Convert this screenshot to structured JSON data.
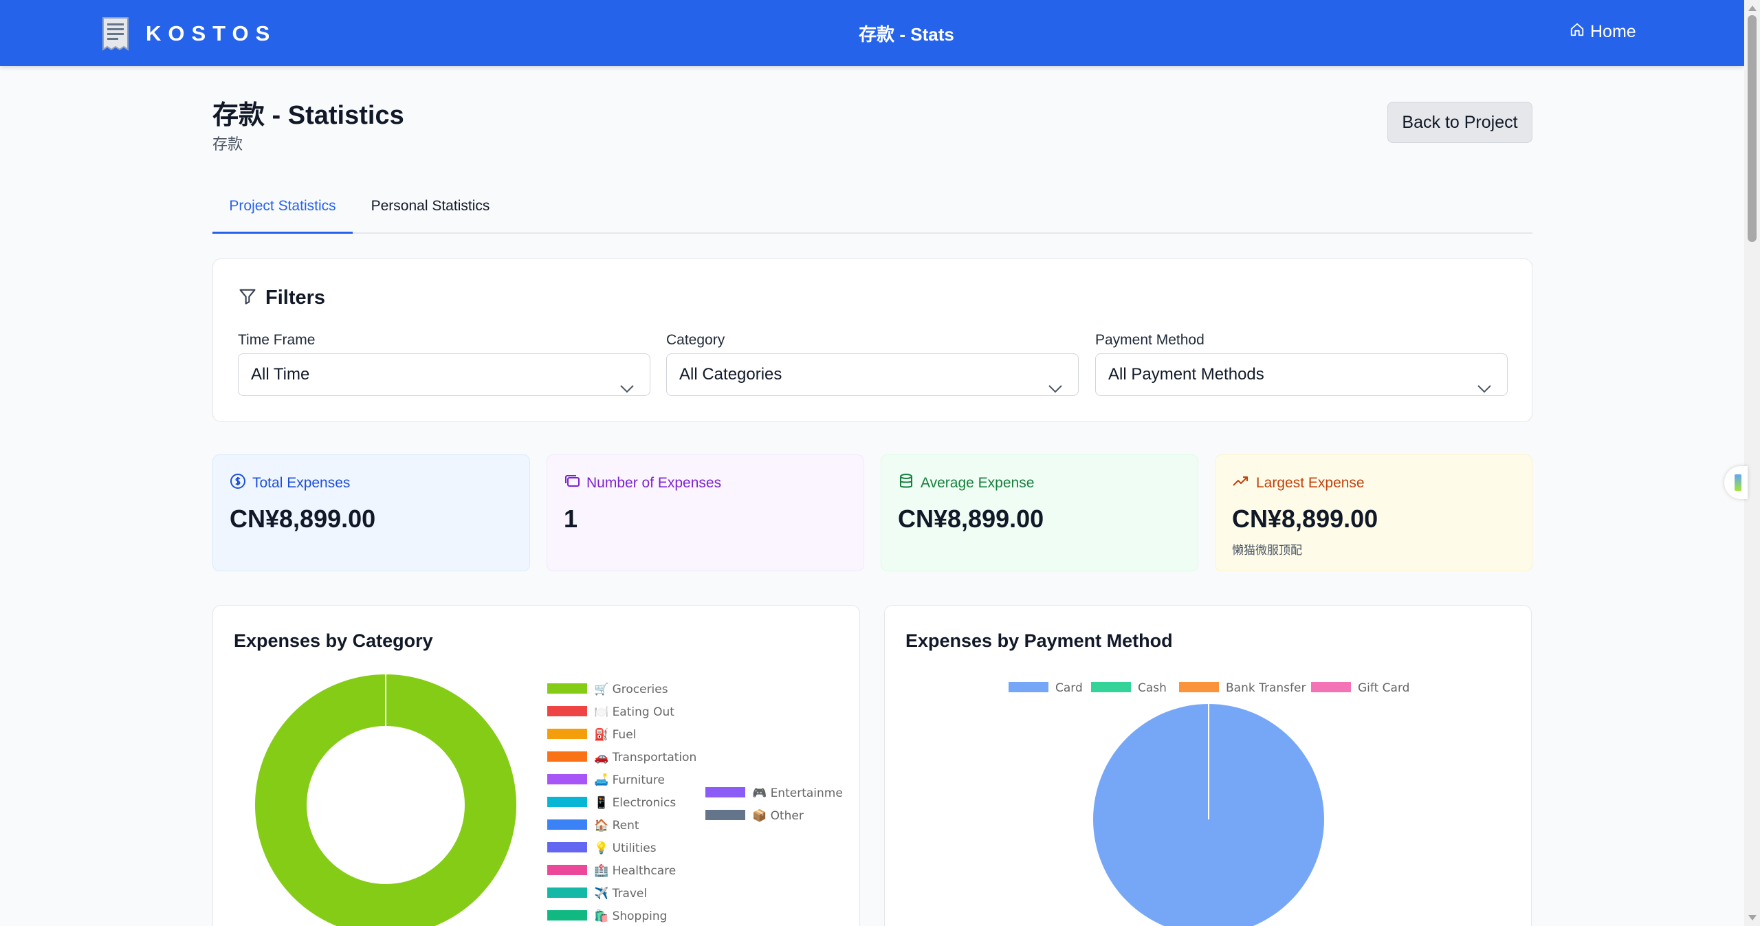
{
  "header": {
    "brand": "KOSTOS",
    "title": "存款 - Stats",
    "home_label": "Home"
  },
  "page": {
    "title": "存款 - Statistics",
    "subtitle": "存款",
    "back_label": "Back to Project"
  },
  "tabs": {
    "project": "Project Statistics",
    "personal": "Personal Statistics",
    "active": "project"
  },
  "filters": {
    "title": "Filters",
    "time_frame": {
      "label": "Time Frame",
      "value": "All Time"
    },
    "category": {
      "label": "Category",
      "value": "All Categories"
    },
    "payment_method": {
      "label": "Payment Method",
      "value": "All Payment Methods"
    }
  },
  "stats": {
    "total": {
      "label": "Total Expenses",
      "value": "CN¥8,899.00",
      "icon": "dollar-circle-icon"
    },
    "count": {
      "label": "Number of Expenses",
      "value": "1",
      "icon": "receipts-icon"
    },
    "average": {
      "label": "Average Expense",
      "value": "CN¥8,899.00",
      "icon": "database-icon"
    },
    "largest": {
      "label": "Largest Expense",
      "value": "CN¥8,899.00",
      "note": "懒猫微服顶配",
      "icon": "trending-up-icon"
    }
  },
  "chart_data": [
    {
      "type": "pie",
      "title": "Expenses by Category",
      "donut": true,
      "legend_position": "right",
      "categories": [
        "🛒 Groceries",
        "🍽️ Eating Out",
        "⛽ Fuel",
        "🚗 Transportation",
        "🛋️ Furniture",
        "📱 Electronics",
        "🏠 Rent",
        "💡 Utilities",
        "🏥 Healthcare",
        "✈️ Travel",
        "🛍️ Shopping",
        "🎮 Entertainme",
        "📦 Other"
      ],
      "colors": [
        "#84cc16",
        "#ef4444",
        "#f59e0b",
        "#f97316",
        "#a855f7",
        "#06b6d4",
        "#3b82f6",
        "#6366f1",
        "#ec4899",
        "#14b8a6",
        "#10b981",
        "#8b5cf6",
        "#64748b"
      ],
      "values": [
        8899,
        0,
        0,
        0,
        0,
        0,
        0,
        0,
        0,
        0,
        0,
        0,
        0
      ]
    },
    {
      "type": "pie",
      "title": "Expenses by Payment Method",
      "donut": false,
      "legend_position": "top",
      "categories": [
        "Card",
        "Cash",
        "Bank Transfer",
        "Gift Card"
      ],
      "colors": [
        "#76a7f7",
        "#34d399",
        "#fb923c",
        "#f472b6"
      ],
      "values": [
        8899,
        0,
        0,
        0
      ]
    }
  ]
}
